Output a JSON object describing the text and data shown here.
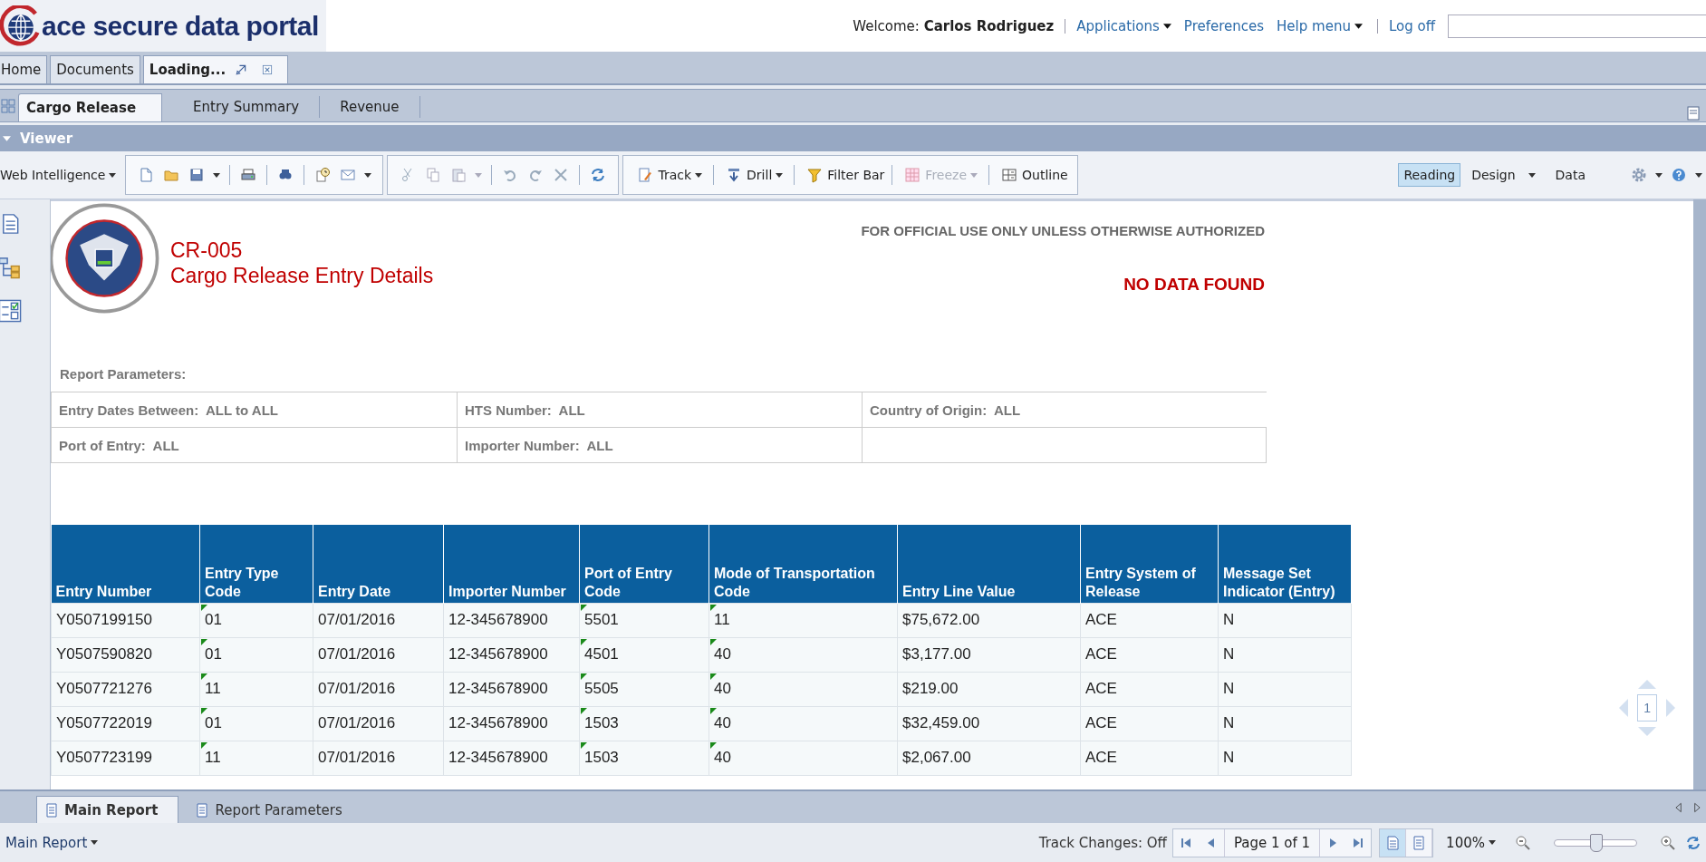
{
  "header": {
    "logo_text": "ace secure data portal",
    "welcome": "Welcome: **Carlos Rodriguez**",
    "links": [
      {
        "label": "Applications",
        "dropdown": true
      },
      {
        "label": "Preferences",
        "dropdown": false
      },
      {
        "label": "Help menu",
        "dropdown": true
      },
      {
        "label": "Log off",
        "dropdown": false
      }
    ]
  },
  "app_tabs": [
    {
      "label": "Home",
      "selected": false
    },
    {
      "label": "Documents",
      "selected": false
    },
    {
      "label": "Loading...",
      "selected": true
    }
  ],
  "document_tabs": [
    {
      "label": "Cargo Release",
      "selected": true
    },
    {
      "label": "Entry Summary",
      "selected": false
    },
    {
      "label": "Revenue",
      "selected": false
    }
  ],
  "viewer_title": "Viewer",
  "toolbar": {
    "menu": "Web Intelligence",
    "actions": [
      {
        "kind": "track",
        "label": "Track",
        "dropdown": true,
        "disabled": false
      },
      {
        "kind": "drill",
        "label": "Drill",
        "dropdown": true,
        "disabled": false
      },
      {
        "kind": "filter",
        "label": "Filter Bar",
        "dropdown": false,
        "disabled": false
      },
      {
        "kind": "freeze",
        "label": "Freeze",
        "dropdown": true,
        "disabled": true
      },
      {
        "kind": "outline",
        "label": "Outline",
        "dropdown": false,
        "disabled": false
      }
    ],
    "modes": [
      {
        "label": "Reading",
        "selected": true,
        "dropdown": false
      },
      {
        "label": "Design",
        "selected": false,
        "dropdown": true
      },
      {
        "label": "Data",
        "selected": false,
        "dropdown": false
      }
    ]
  },
  "report": {
    "code": "CR-005",
    "title": "Cargo Release Entry Details",
    "notice": "FOR OFFICIAL USE ONLY UNLESS OTHERWISE AUTHORIZED",
    "status": "NO DATA FOUND",
    "parameters_heading": "Report Parameters:",
    "parameters": [
      [
        "Entry Dates Between:  ALL to ALL",
        "HTS Number:  ALL",
        "Country of Origin:  ALL"
      ],
      [
        "Port of Entry:  ALL",
        "Importer Number:  ALL"
      ]
    ],
    "table": {
      "columns": [
        {
          "label": "Entry Number",
          "marked": false
        },
        {
          "label": "Entry Type Code",
          "marked": true
        },
        {
          "label": "Entry Date",
          "marked": false
        },
        {
          "label": "Importer Number",
          "marked": false
        },
        {
          "label": "Port of Entry Code",
          "marked": true
        },
        {
          "label": "Mode of Transportation Code",
          "marked": true
        },
        {
          "label": "Entry Line Value",
          "marked": false
        },
        {
          "label": "Entry System of Release",
          "marked": false
        },
        {
          "label": "Message Set Indicator (Entry)",
          "marked": false
        }
      ],
      "rows": [
        [
          "Y0507199150",
          "01",
          "07/01/2016",
          "12-345678900",
          "5501",
          "11",
          "$75,672.00",
          "ACE",
          "N"
        ],
        [
          "Y0507590820",
          "01",
          "07/01/2016",
          "12-345678900",
          "4501",
          "40",
          "$3,177.00",
          "ACE",
          "N"
        ],
        [
          "Y0507721276",
          "11",
          "07/01/2016",
          "12-345678900",
          "5505",
          "40",
          "$219.00",
          "ACE",
          "N"
        ],
        [
          "Y0507722019",
          "01",
          "07/01/2016",
          "12-345678900",
          "1503",
          "40",
          "$32,459.00",
          "ACE",
          "N"
        ],
        [
          "Y0507723199",
          "11",
          "07/01/2016",
          "12-345678900",
          "1503",
          "40",
          "$2,067.00",
          "ACE",
          "N"
        ]
      ]
    }
  },
  "page_navigator": {
    "page": "1"
  },
  "report_tabs": [
    {
      "label": "Main Report",
      "selected": true
    },
    {
      "label": "Report Parameters",
      "selected": false
    }
  ],
  "status_bar": {
    "report_menu": "Main Report",
    "track_changes": "Track Changes: Off",
    "page": "Page 1 of 1",
    "view_modes": [
      {
        "kind": "page",
        "selected": true
      },
      {
        "kind": "document",
        "selected": false
      }
    ],
    "zoom": "100%",
    "zoom_slider": {
      "level": 0.5
    }
  }
}
